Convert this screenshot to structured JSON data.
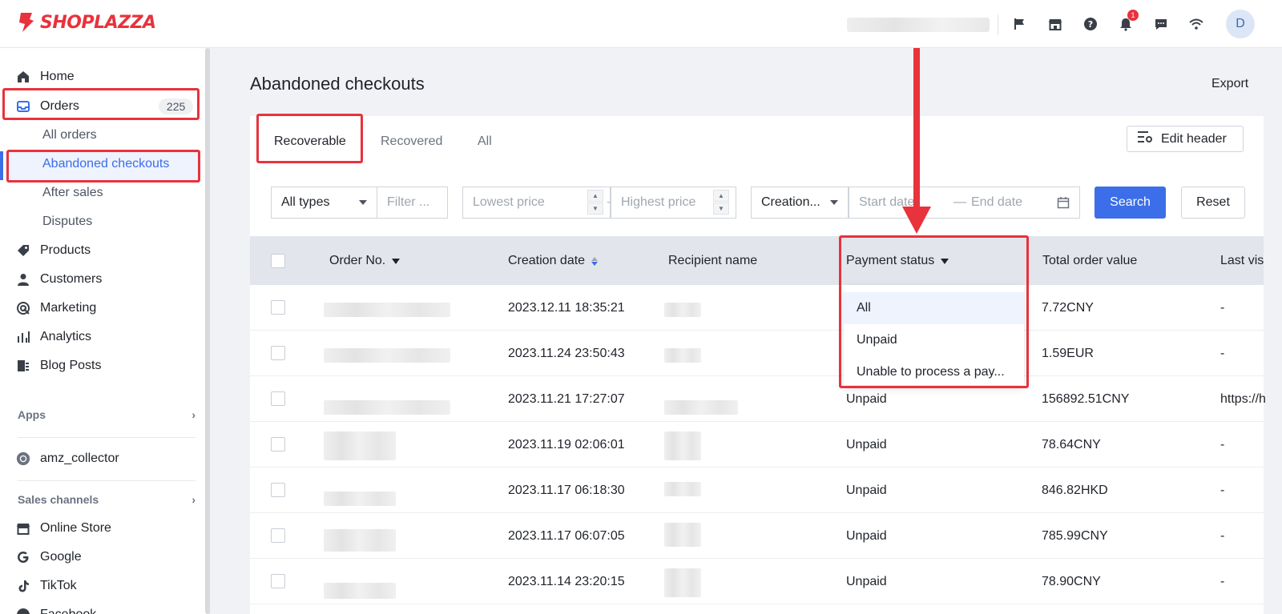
{
  "brand": {
    "name": "SHOPLAZZA",
    "accent": "#3b6ee8",
    "brand_red": "#e8323c"
  },
  "topbar": {
    "icons": [
      "flag-icon",
      "store-icon",
      "help-icon",
      "bell-icon",
      "chat-icon",
      "wifi-icon"
    ],
    "notification_count": "1",
    "avatar_initial": "D"
  },
  "sidebar": {
    "home": "Home",
    "orders": "Orders",
    "orders_count": "225",
    "orders_sub": [
      "All orders",
      "Abandoned checkouts",
      "After sales",
      "Disputes"
    ],
    "products": "Products",
    "customers": "Customers",
    "marketing": "Marketing",
    "analytics": "Analytics",
    "blog": "Blog Posts",
    "apps_label": "Apps",
    "app_item": "amz_collector",
    "sales_label": "Sales channels",
    "channels": [
      "Online Store",
      "Google",
      "TikTok",
      "Facebook"
    ]
  },
  "main": {
    "title": "Abandoned checkouts",
    "export": "Export",
    "tabs": [
      "Recoverable",
      "Recovered",
      "All"
    ],
    "edit_header": "Edit header"
  },
  "filters": {
    "type_value": "All types",
    "filter_placeholder": "Filter ...",
    "lowest_placeholder": "Lowest price",
    "range_sep": "~",
    "highest_placeholder": "Highest price",
    "date_type_value": "Creation...",
    "start_placeholder": "Start date",
    "date_sep": "—",
    "end_placeholder": "End date",
    "search": "Search",
    "reset": "Reset"
  },
  "table": {
    "columns": [
      "Order No.",
      "Creation date",
      "Recipient name",
      "Payment status",
      "Total order value",
      "Last vis"
    ],
    "rows": [
      {
        "date": "2023.12.11 18:35:21",
        "status": "",
        "total": "7.72CNY",
        "last": "-"
      },
      {
        "date": "2023.11.24 23:50:43",
        "status": "",
        "total": "1.59EUR",
        "last": "-"
      },
      {
        "date": "2023.11.21 17:27:07",
        "status": "Unpaid",
        "total": "156892.51CNY",
        "last": "https://h"
      },
      {
        "date": "2023.11.19 02:06:01",
        "status": "Unpaid",
        "total": "78.64CNY",
        "last": "-"
      },
      {
        "date": "2023.11.17 06:18:30",
        "status": "Unpaid",
        "total": "846.82HKD",
        "last": "-"
      },
      {
        "date": "2023.11.17 06:07:05",
        "status": "Unpaid",
        "total": "785.99CNY",
        "last": "-"
      },
      {
        "date": "2023.11.14 23:20:15",
        "status": "Unpaid",
        "total": "78.90CNY",
        "last": "-"
      }
    ]
  },
  "payment_dropdown": {
    "options": [
      "All",
      "Unpaid",
      "Unable to process a pay..."
    ],
    "selected": "All"
  }
}
